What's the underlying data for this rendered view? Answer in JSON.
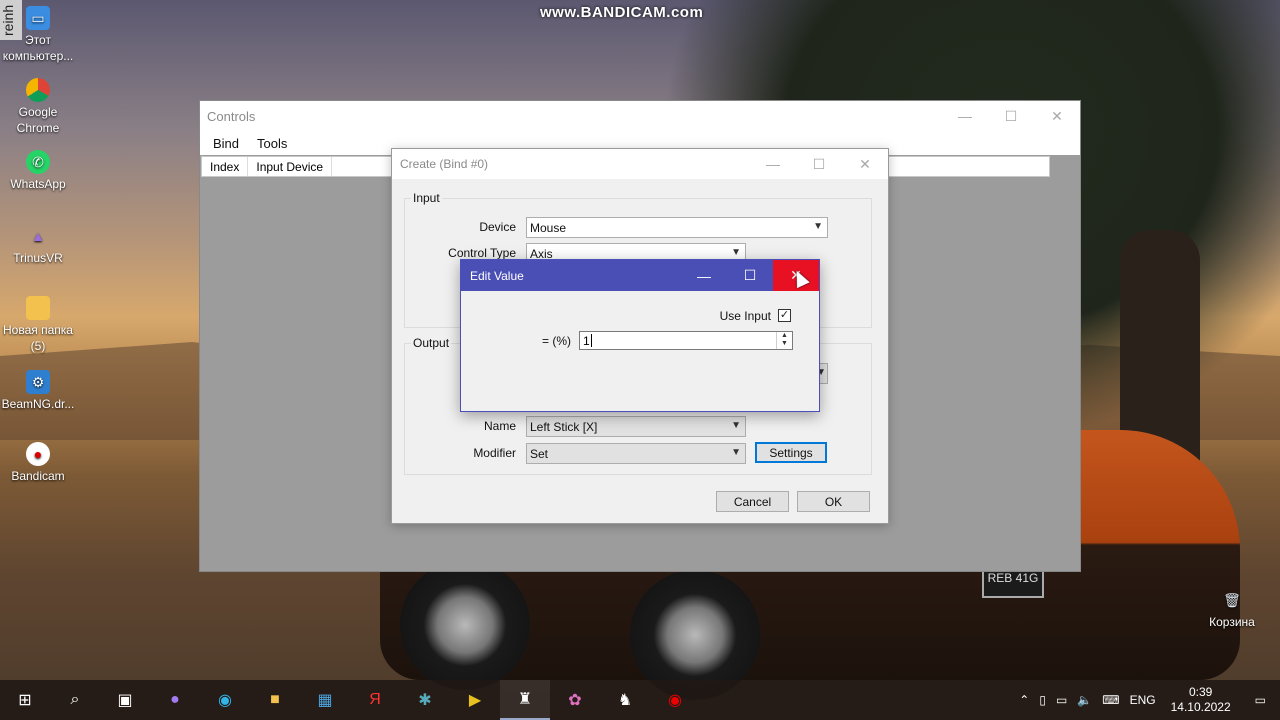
{
  "watermark": "www.BANDICAM.com",
  "desktop": {
    "sidebar_fragment": "reinh",
    "icons": [
      {
        "label": "Этот компьютер..."
      },
      {
        "label": "Google Chrome"
      },
      {
        "label": "WhatsApp"
      },
      {
        "label": "TrinusVR"
      },
      {
        "label": "Новая папка (5)"
      },
      {
        "label": "BeamNG.dr..."
      },
      {
        "label": "Bandicam"
      }
    ],
    "recycle_bin": "Корзина",
    "plate": "REB 41G"
  },
  "controls_window": {
    "title": "Controls",
    "menu": [
      "Bind",
      "Tools"
    ],
    "columns": [
      "Index",
      "Input Device"
    ]
  },
  "create_dialog": {
    "title": "Create (Bind #0)",
    "input_group": "Input",
    "device_label": "Device",
    "device_value": "Mouse",
    "control_type_label": "Control Type",
    "control_type_value": "Axis",
    "output_group": "Output",
    "name_label": "Name",
    "name_value": "Left Stick [X]",
    "modifier_label": "Modifier",
    "modifier_value": "Set",
    "settings_button": "Settings",
    "cancel_button": "Cancel",
    "ok_button": "OK"
  },
  "edit_dialog": {
    "title": "Edit Value",
    "use_input_label": "Use Input",
    "use_input_checked": true,
    "value_label": "= (%)",
    "value": "1"
  },
  "taskbar": {
    "language": "ENG",
    "time": "0:39",
    "date": "14.10.2022"
  },
  "colors": {
    "edit_titlebar": "#4a4fb5",
    "close_hover": "#e81123",
    "focus_border": "#0078d7"
  }
}
